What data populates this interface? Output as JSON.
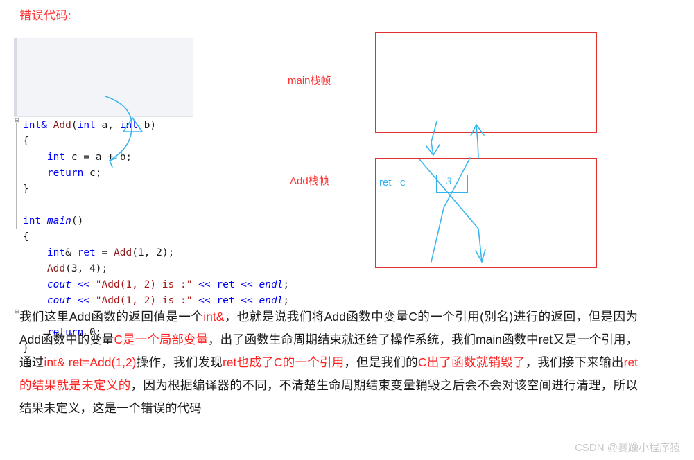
{
  "heading": "错误代码:",
  "code": {
    "lines": [
      {
        "fold": true,
        "tokens": [
          {
            "t": "int",
            "c": "kw"
          },
          {
            "t": "& ",
            "c": "kw"
          },
          {
            "t": "Add",
            "c": "fn"
          },
          {
            "t": "(",
            "c": "pln"
          },
          {
            "t": "int",
            "c": "kw"
          },
          {
            "t": " a, ",
            "c": "pln"
          },
          {
            "t": "int",
            "c": "kw"
          },
          {
            "t": " b)",
            "c": "pln"
          }
        ]
      },
      {
        "fold": false,
        "tokens": [
          {
            "t": "{",
            "c": "pln"
          }
        ]
      },
      {
        "fold": false,
        "tokens": [
          {
            "t": "    ",
            "c": "pln"
          },
          {
            "t": "int",
            "c": "kw"
          },
          {
            "t": " c = a + b;",
            "c": "pln"
          }
        ]
      },
      {
        "fold": false,
        "tokens": [
          {
            "t": "    ",
            "c": "pln"
          },
          {
            "t": "return",
            "c": "kw"
          },
          {
            "t": " c;",
            "c": "pln"
          }
        ]
      },
      {
        "fold": false,
        "tokens": [
          {
            "t": "}",
            "c": "pln"
          }
        ]
      },
      {
        "fold": false,
        "tokens": [
          {
            "t": "",
            "c": "pln"
          }
        ]
      },
      {
        "fold": true,
        "tokens": [
          {
            "t": "int ",
            "c": "kw"
          },
          {
            "t": "main",
            "c": "mainname"
          },
          {
            "t": "()",
            "c": "pln"
          }
        ]
      },
      {
        "fold": false,
        "tokens": [
          {
            "t": "{",
            "c": "pln"
          }
        ]
      },
      {
        "fold": false,
        "tokens": [
          {
            "t": "    ",
            "c": "pln"
          },
          {
            "t": "int",
            "c": "kw"
          },
          {
            "t": "& ",
            "c": "pln"
          },
          {
            "t": "ret",
            "c": "kw"
          },
          {
            "t": " = ",
            "c": "pln"
          },
          {
            "t": "Add",
            "c": "fn"
          },
          {
            "t": "(1, 2);",
            "c": "pln"
          }
        ]
      },
      {
        "fold": false,
        "tokens": [
          {
            "t": "    ",
            "c": "pln"
          },
          {
            "t": "Add",
            "c": "fn"
          },
          {
            "t": "(3, 4);",
            "c": "pln"
          }
        ]
      },
      {
        "fold": false,
        "tokens": [
          {
            "t": "    ",
            "c": "pln"
          },
          {
            "t": "cout",
            "c": "ital"
          },
          {
            "t": " << ",
            "c": "kw"
          },
          {
            "t": "\"Add(1, 2) is :\"",
            "c": "str"
          },
          {
            "t": " << ",
            "c": "kw"
          },
          {
            "t": "ret",
            "c": "kw"
          },
          {
            "t": " << ",
            "c": "kw"
          },
          {
            "t": "endl",
            "c": "ital"
          },
          {
            "t": ";",
            "c": "pln"
          }
        ]
      },
      {
        "fold": false,
        "tokens": [
          {
            "t": "    ",
            "c": "pln"
          },
          {
            "t": "cout",
            "c": "ital"
          },
          {
            "t": " << ",
            "c": "kw"
          },
          {
            "t": "\"Add(1, 2) is :\"",
            "c": "str"
          },
          {
            "t": " << ",
            "c": "kw"
          },
          {
            "t": "ret",
            "c": "kw"
          },
          {
            "t": " << ",
            "c": "kw"
          },
          {
            "t": "endl",
            "c": "ital"
          },
          {
            "t": ";",
            "c": "pln"
          }
        ]
      },
      {
        "fold": false,
        "tokens": [
          {
            "t": "",
            "c": "pln"
          }
        ]
      },
      {
        "fold": false,
        "tokens": [
          {
            "t": "    ",
            "c": "pln"
          },
          {
            "t": "return",
            "c": "kw"
          },
          {
            "t": " 0;",
            "c": "pln"
          }
        ]
      },
      {
        "fold": false,
        "tokens": [
          {
            "t": "}",
            "c": "pln"
          }
        ]
      }
    ],
    "fold_glyph": "⊟"
  },
  "diagram": {
    "main_frame_label": "main栈帧",
    "add_frame_label": "Add栈帧",
    "add_slot_label": "ret   c",
    "value_box_text": "3",
    "frame_border_color": "#e03030",
    "annotation_color": "#2fb2ef"
  },
  "paragraph": {
    "segments": [
      {
        "text": "我们这里Add函数的返回值是一个",
        "color": "black"
      },
      {
        "text": "int&",
        "color": "red"
      },
      {
        "text": "，也就是说我们将Add函数中变量C的一个引用(别名)进行的返回，但是因为Add函数中的变量",
        "color": "black"
      },
      {
        "text": "C是一个局部变量",
        "color": "red"
      },
      {
        "text": "，出了函数生命周期结束就还给了操作系统，我们main函数中ret又是一个引用，通过",
        "color": "black"
      },
      {
        "text": "int& ret=Add(1,2)",
        "color": "red"
      },
      {
        "text": "操作，我们发现",
        "color": "black"
      },
      {
        "text": "ret也成了C的一个引用",
        "color": "red"
      },
      {
        "text": "，但是我们的",
        "color": "black"
      },
      {
        "text": "C出了函数就销毁了",
        "color": "red"
      },
      {
        "text": "，我们接下来输出",
        "color": "black"
      },
      {
        "text": "ret的结果就是未定义的",
        "color": "red"
      },
      {
        "text": "，因为根据编译器的不同，不清楚生命周期结束变量销毁之后会不会对该空间进行清理，所以结果未定义，这是一个错误的代码",
        "color": "black"
      }
    ]
  },
  "watermark": "CSDN @暴躁小程序猿"
}
